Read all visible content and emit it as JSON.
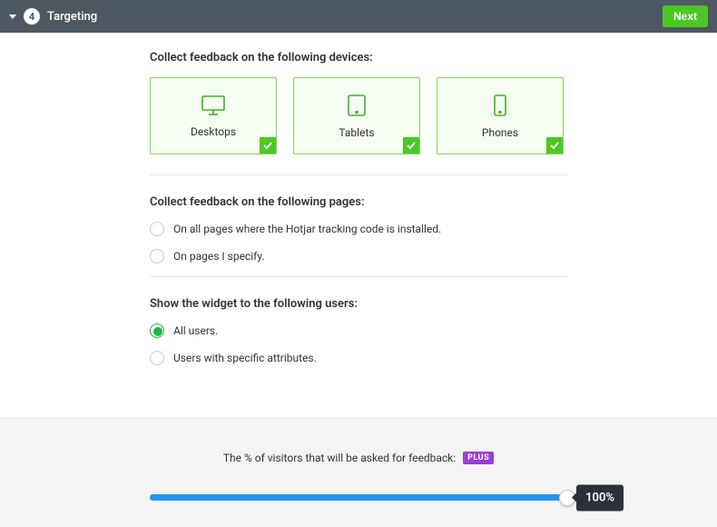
{
  "header": {
    "step": "4",
    "title": "Targeting",
    "next": "Next"
  },
  "devices": {
    "title": "Collect feedback on the following devices:",
    "options": {
      "desktops": "Desktops",
      "tablets": "Tablets",
      "phones": "Phones"
    }
  },
  "pages": {
    "title": "Collect feedback on the following pages:",
    "all": "On all pages where the Hotjar tracking code is installed.",
    "specific": "On pages I specify."
  },
  "users": {
    "title": "Show the widget to the following users:",
    "all": "All users.",
    "specific": "Users with specific attributes."
  },
  "slider": {
    "title": "The % of visitors that will be asked for feedback:",
    "badge": "PLUS",
    "value": "100%"
  }
}
